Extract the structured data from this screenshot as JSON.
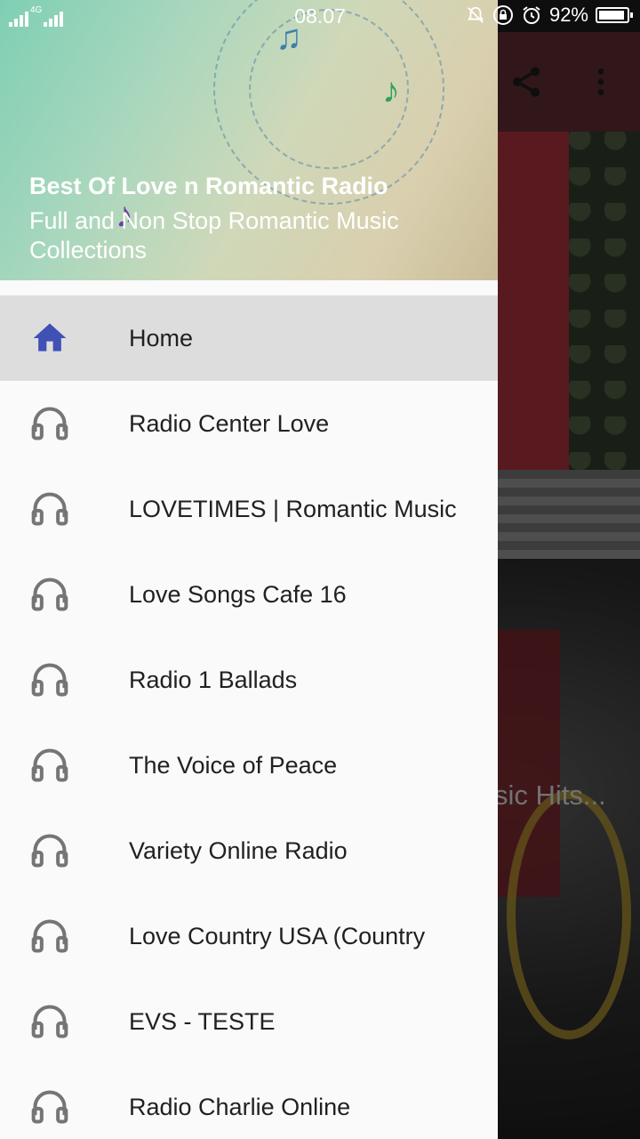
{
  "status_bar": {
    "time": "08.07",
    "network": "4G",
    "battery": "92%",
    "battery_level": 0.92,
    "icons": [
      "signal-icon",
      "mute-icon",
      "lock-rotation-icon",
      "alarm-icon",
      "battery-icon"
    ]
  },
  "drawer": {
    "header": {
      "title": "Best Of Love n Romantic Radio",
      "subtitle": "Full and Non Stop Romantic Music Collections"
    },
    "items": [
      {
        "label": "Home",
        "icon": "home-icon",
        "active": true
      },
      {
        "label": "Radio Center Love",
        "icon": "headphones-icon"
      },
      {
        "label": "LOVETIMES | Romantic Music",
        "icon": "headphones-icon"
      },
      {
        "label": "Love Songs Cafe 16",
        "icon": "headphones-icon"
      },
      {
        "label": "Radio 1 Ballads",
        "icon": "headphones-icon"
      },
      {
        "label": "The Voice of Peace",
        "icon": "headphones-icon"
      },
      {
        "label": "Variety Online Radio",
        "icon": "headphones-icon"
      },
      {
        "label": "Love Country USA (Country",
        "icon": "headphones-icon"
      },
      {
        "label": "EVS - TESTE",
        "icon": "headphones-icon"
      },
      {
        "label": "Radio Charlie Online",
        "icon": "headphones-icon"
      }
    ]
  },
  "background": {
    "card_title_partial": "sic Hits...",
    "toolbar_icons": [
      "share-icon",
      "more-vert-icon"
    ]
  },
  "colors": {
    "toolbar": "#5a2a2f",
    "accent": "#3f51b5",
    "icon_gray": "#757575",
    "active_item_bg": "#dddddd"
  }
}
